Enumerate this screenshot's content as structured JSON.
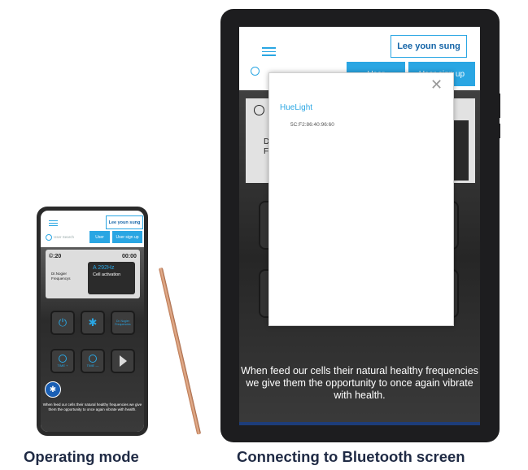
{
  "captions": {
    "left": "Operating mode",
    "right": "Connecting to Bluetooth screen"
  },
  "phone": {
    "header": {
      "user_name": "Lee youn sung",
      "search_placeholder": "User Search",
      "user_tab": "User",
      "signup_tab": "User sign up"
    },
    "player": {
      "timer_left": "©:20",
      "timer_right": "00:00",
      "program_name": "Dr.Nogier Frequencys",
      "frequency": "A 292Hz",
      "mode": "Cell activation"
    },
    "controls": {
      "nogier_button": "Dr. Nogier Frequencies",
      "time_plus": "TIME +",
      "time_minus": "TIME —"
    },
    "footer_text": "When feed our cells their natural healthy frequencies we give them the opportunity to once again vibrate with health."
  },
  "tablet": {
    "header": {
      "user_name": "Lee youn sung",
      "user_tab": "User",
      "signup_tab": "User sign up"
    },
    "card": {
      "timer_right": ":-",
      "program_name": "Dr\nF"
    },
    "dialog": {
      "device_name": "HueLight",
      "mac_address": "5C:F2:86:40:96:60",
      "close_symbol": "✕"
    },
    "footer_text": "When feed our cells their natural healthy frequencies we give them the opportunity to once again vibrate with health."
  },
  "colors": {
    "accent": "#2aa6e3",
    "brand_dark_blue": "#1565a8",
    "device_frame": "#1d1d1f",
    "stylus": "#c98a62"
  }
}
